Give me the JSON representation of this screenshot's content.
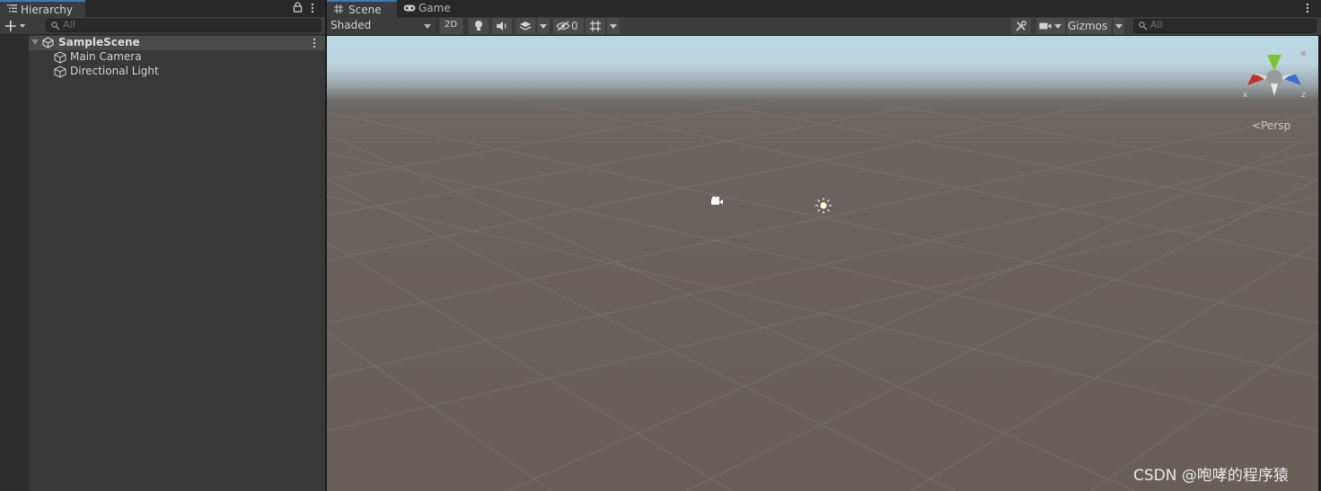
{
  "hierarchy": {
    "tab_label": "Hierarchy",
    "search_placeholder": "All",
    "scene_name": "SampleScene",
    "objects": [
      {
        "label": "Main Camera"
      },
      {
        "label": "Directional Light"
      }
    ]
  },
  "scene_view": {
    "tabs": [
      {
        "label": "Scene",
        "icon": "grid-icon",
        "active": true
      },
      {
        "label": "Game",
        "icon": "gamepad-icon",
        "active": false
      }
    ],
    "draw_mode": "Shaded",
    "mode_2d_label": "2D",
    "hidden_count": "0",
    "gizmos_label": "Gizmos",
    "search_placeholder": "All",
    "projection_label": "Persp",
    "axis_labels": {
      "x": "x",
      "y": "y",
      "z": "z"
    },
    "colors": {
      "accent": "#3a79bb",
      "axis_x": "#c0322c",
      "axis_y": "#7cc433",
      "axis_z": "#3a6bd6"
    }
  },
  "watermark": "CSDN @咆哮的程序猿"
}
